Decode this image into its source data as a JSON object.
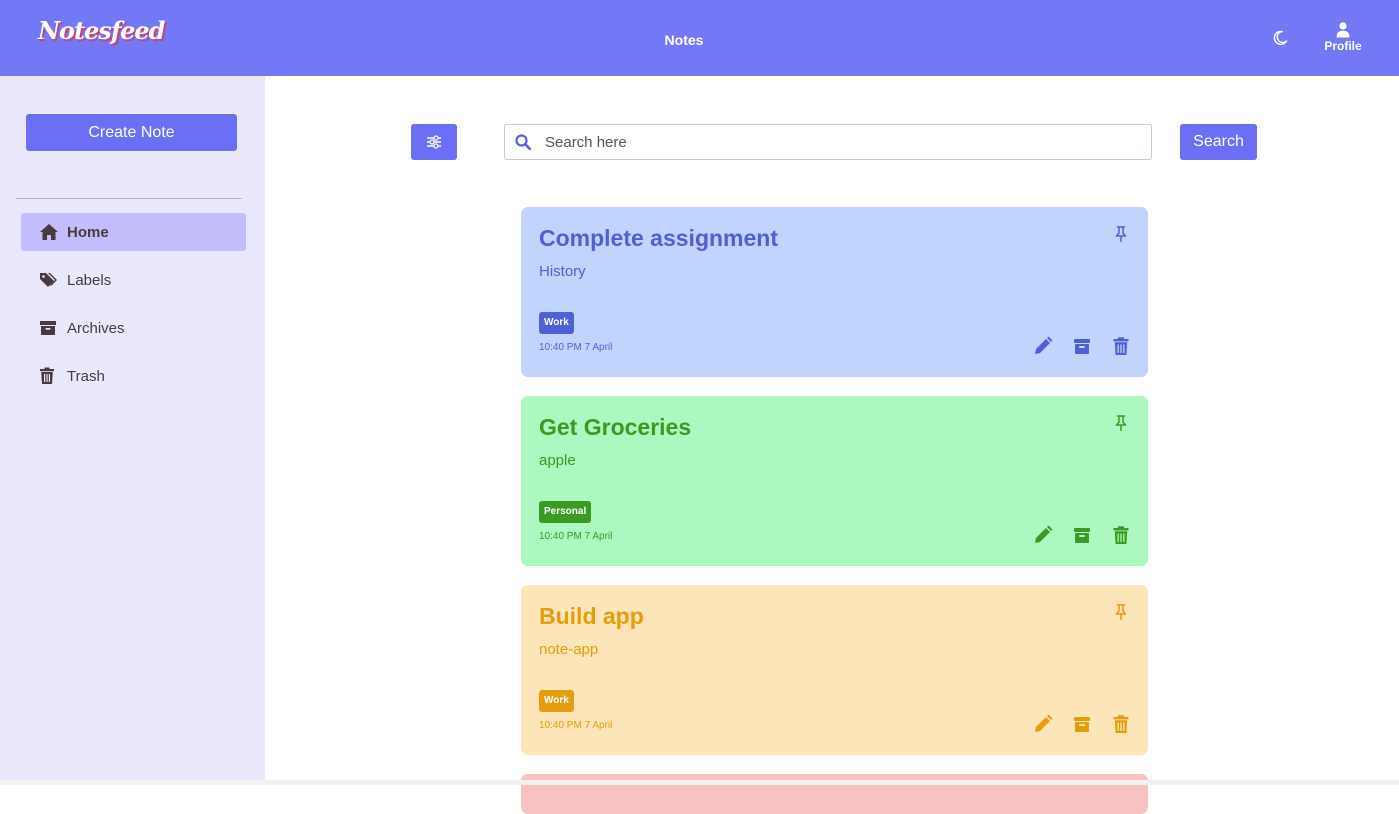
{
  "header": {
    "logo": "Notesfeed",
    "title": "Notes",
    "profile_label": "Profile",
    "theme_icon": "moon-icon",
    "profile_icon": "user-icon"
  },
  "colors": {
    "header_bg": "#7378f7",
    "sidebar_bg": "#e9e8fc",
    "accent": "#6a6ff5",
    "active_nav": "#c3bdfb"
  },
  "sidebar": {
    "create_label": "Create Note",
    "items": [
      {
        "label": "Home",
        "icon": "home-icon",
        "active": true
      },
      {
        "label": "Labels",
        "icon": "tags-icon",
        "active": false
      },
      {
        "label": "Archives",
        "icon": "archive-icon",
        "active": false
      },
      {
        "label": "Trash",
        "icon": "trash-icon",
        "active": false
      }
    ]
  },
  "toolbar": {
    "filter_icon": "sliders-icon",
    "search_placeholder": "Search here",
    "search_value": "",
    "search_label": "Search"
  },
  "notes": [
    {
      "title": "Complete assignment",
      "body": "History",
      "tag": "Work",
      "date": "10:40 PM 7 April",
      "color": "#c1d4fd",
      "text_color": "#4f5fd6"
    },
    {
      "title": "Get Groceries",
      "body": "apple",
      "tag": "Personal",
      "date": "10:40 PM 7 April",
      "color": "#adf8c0",
      "text_color": "#3a9a22"
    },
    {
      "title": "Build app",
      "body": "note-app",
      "tag": "Work",
      "date": "10:40 PM 7 April",
      "color": "#fce5b9",
      "text_color": "#e59c0e"
    },
    {
      "color": "#f9c2c2"
    }
  ]
}
